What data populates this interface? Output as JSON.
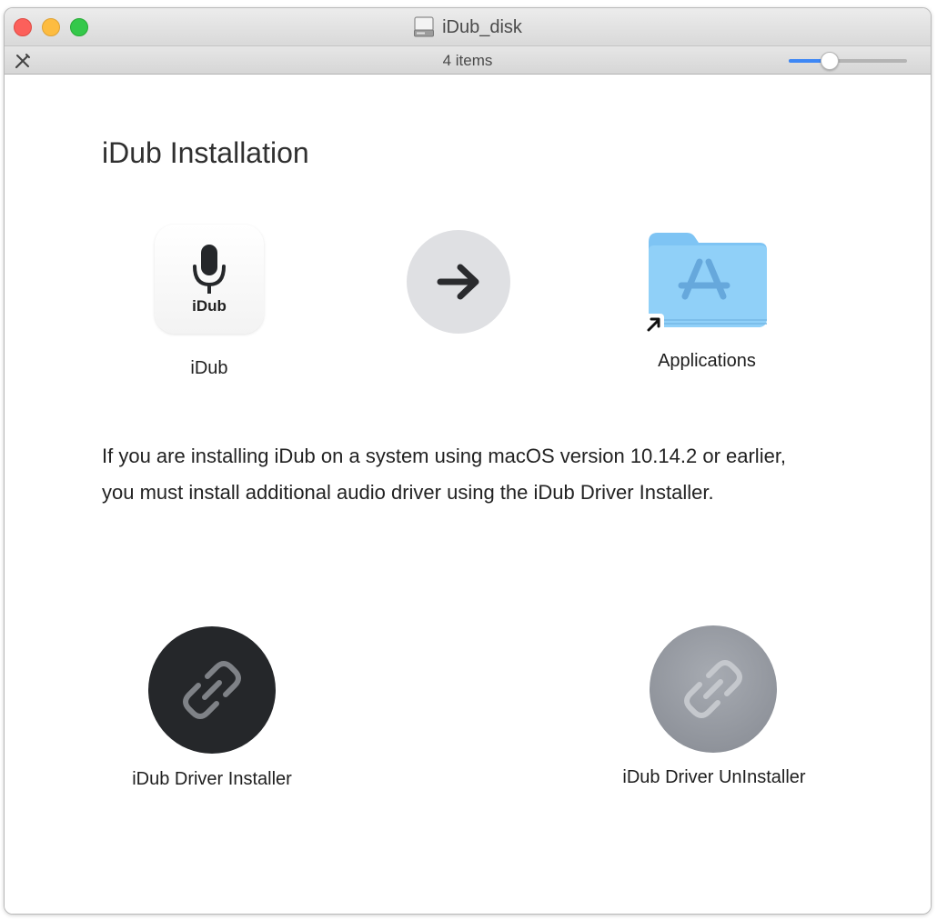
{
  "window": {
    "title": "iDub_disk",
    "items_count": "4 items",
    "icon_size_slider": 0.32,
    "traffic_lights": {
      "close": "#fc605b",
      "minimize": "#fdbc40",
      "zoom": "#34c84a"
    }
  },
  "installer": {
    "heading": "iDub Installation",
    "app_icon_text": "iDub",
    "app_label": "iDub",
    "applications_label": "Applications",
    "description": "If you are installing iDub on a system using macOS version 10.14.2 or earlier, you must install additional audio driver using the iDub Driver Installer.",
    "driver_installer_label": "iDub Driver Installer",
    "driver_uninstaller_label": "iDub Driver UnInstaller"
  },
  "icons": [
    "disk-icon",
    "tools-icon",
    "microphone-icon",
    "arrow-right-icon",
    "applications-folder-icon",
    "alias-arrow-icon",
    "link-icon"
  ],
  "colors": {
    "accent": "#3d87f5",
    "folder": "#7ec4f4",
    "installer_bg": "#25272a",
    "uninstaller_bg": "#9a9ea5"
  }
}
